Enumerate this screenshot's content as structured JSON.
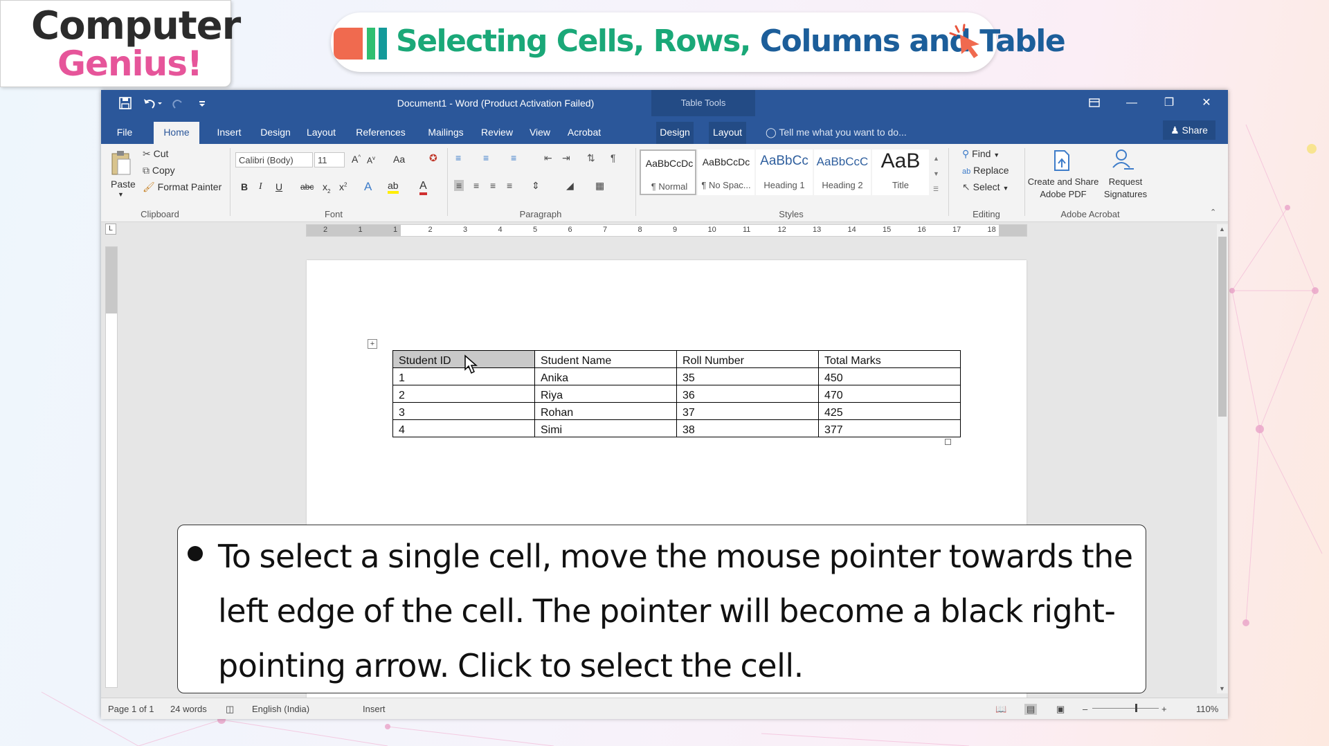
{
  "logo": {
    "line1": "Computer",
    "line2": "Genius!"
  },
  "slide_title": {
    "part1": "Selecting Cells, Rows, ",
    "part2": "Columns and Table"
  },
  "window": {
    "title": "Document1 - Word (Product Activation Failed)",
    "context_label": "Table Tools",
    "tabs": [
      "File",
      "Home",
      "Insert",
      "Design",
      "Layout",
      "References",
      "Mailings",
      "Review",
      "View",
      "Acrobat",
      "Design",
      "Layout"
    ],
    "active_tab": "Home",
    "tell_me": "Tell me what you want to do...",
    "share": "Share"
  },
  "ribbon": {
    "clipboard": {
      "paste": "Paste",
      "cut": "Cut",
      "copy": "Copy",
      "format_painter": "Format Painter",
      "label": "Clipboard"
    },
    "font": {
      "name": "Calibri (Body)",
      "size": "11",
      "label": "Font",
      "case": "Aa"
    },
    "paragraph": {
      "label": "Paragraph"
    },
    "styles": {
      "label": "Styles",
      "items": [
        {
          "preview": "AaBbCcDc",
          "name": "¶ Normal"
        },
        {
          "preview": "AaBbCcDc",
          "name": "¶ No Spac..."
        },
        {
          "preview": "AaBbCc",
          "name": "Heading 1"
        },
        {
          "preview": "AaBbCcC",
          "name": "Heading 2"
        },
        {
          "preview": "AaB",
          "name": "Title"
        }
      ]
    },
    "editing": {
      "find": "Find",
      "replace": "Replace",
      "select": "Select",
      "label": "Editing"
    },
    "acrobat": {
      "create_line1": "Create and Share",
      "create_line2": "Adobe PDF",
      "request_line1": "Request",
      "request_line2": "Signatures",
      "label": "Adobe Acrobat"
    }
  },
  "ruler_numbers": [
    "2",
    "1",
    "1",
    "2",
    "3",
    "4",
    "5",
    "6",
    "7",
    "8",
    "9",
    "10",
    "11",
    "12",
    "13",
    "14",
    "15",
    "16",
    "17",
    "18"
  ],
  "table": {
    "headers": [
      "Student ID",
      "Student Name",
      "Roll Number",
      "Total Marks"
    ],
    "rows": [
      [
        "1",
        "Anika",
        "35",
        "450"
      ],
      [
        "2",
        "Riya",
        "36",
        "470"
      ],
      [
        "3",
        "Rohan",
        "37",
        "425"
      ],
      [
        "4",
        "Simi",
        "38",
        "377"
      ]
    ]
  },
  "status": {
    "page": "Page 1 of 1",
    "words": "24 words",
    "language": "English (India)",
    "mode": "Insert",
    "zoom": "110%"
  },
  "caption": "To select a single cell, move the mouse pointer towards the left edge of the cell. The pointer will become a black right-pointing arrow. Click to select the cell.",
  "colors": {
    "word_blue": "#2b579a",
    "title_green": "#1aa878",
    "title_blue": "#1c5e9a",
    "logo_pink": "#e6559a"
  }
}
